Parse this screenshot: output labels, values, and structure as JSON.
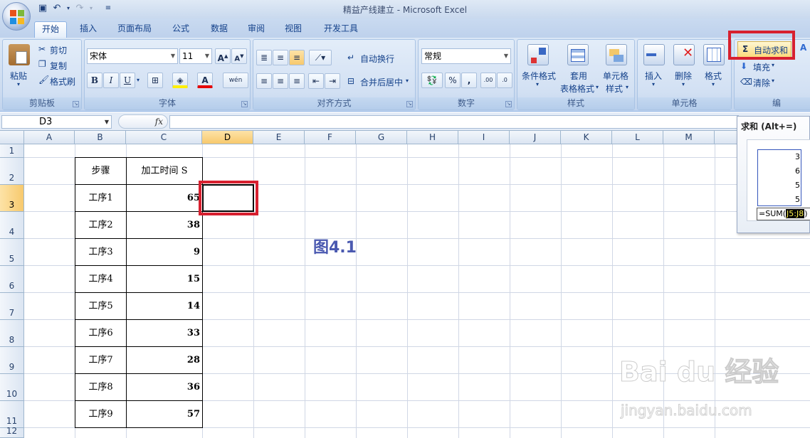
{
  "window": {
    "title": "精益产线建立 - Microsoft Excel"
  },
  "tabs": [
    "开始",
    "插入",
    "页面布局",
    "公式",
    "数据",
    "审阅",
    "视图",
    "开发工具"
  ],
  "clipboard": {
    "paste": "粘贴",
    "cut": "剪切",
    "copy": "复制",
    "format_painter": "格式刷",
    "label": "剪贴板"
  },
  "font": {
    "name": "宋体",
    "size": "11",
    "bold": "B",
    "italic": "I",
    "underline": "U",
    "phonetic": "wén",
    "label": "字体"
  },
  "alignment": {
    "wrap": "自动换行",
    "merge": "合并后居中",
    "label": "对齐方式"
  },
  "number": {
    "format": "常规",
    "percent": "%",
    "comma": ",",
    "label": "数字"
  },
  "styles": {
    "conditional": "条件格式",
    "table": "套用表格格式",
    "table_l1": "套用",
    "table_l2": "表格格式",
    "cell": "单元格样式",
    "cell_l1": "单元格",
    "cell_l2": "样式",
    "label": "样式"
  },
  "cells": {
    "insert": "插入",
    "delete": "删除",
    "format": "格式",
    "label": "单元格"
  },
  "editing": {
    "autosum": "自动求和",
    "fill": "填充",
    "clear": "清除",
    "label": "编"
  },
  "formula_bar": {
    "name_box": "D3",
    "fx": "fx",
    "formula": ""
  },
  "columns": [
    "A",
    "B",
    "C",
    "D",
    "E",
    "F",
    "G",
    "H",
    "I",
    "J",
    "K",
    "L",
    "M"
  ],
  "rows": [
    "1",
    "2",
    "3",
    "4",
    "5",
    "6",
    "7",
    "8",
    "9",
    "10",
    "11",
    "12"
  ],
  "table": {
    "header_step": "步骤",
    "header_time": "加工时间 S",
    "rows": [
      {
        "step": "工序1",
        "time": "65"
      },
      {
        "step": "工序2",
        "time": "38"
      },
      {
        "step": "工序3",
        "time": "9"
      },
      {
        "step": "工序4",
        "time": "15"
      },
      {
        "step": "工序5",
        "time": "14"
      },
      {
        "step": "工序6",
        "time": "33"
      },
      {
        "step": "工序7",
        "time": "28"
      },
      {
        "step": "工序8",
        "time": "36"
      },
      {
        "step": "工序9",
        "time": "57"
      }
    ]
  },
  "figure_label": "图4.1",
  "tooltip": {
    "title": "求和 (Alt+=)",
    "values": [
      "3",
      "6",
      "5",
      "5"
    ],
    "formula_prefix": "=SUM(",
    "formula_ref": "J5:J8",
    "formula_suffix": ")"
  },
  "watermark": {
    "brand": "Bai du 经验",
    "url": "jingyan.baidu.com"
  }
}
